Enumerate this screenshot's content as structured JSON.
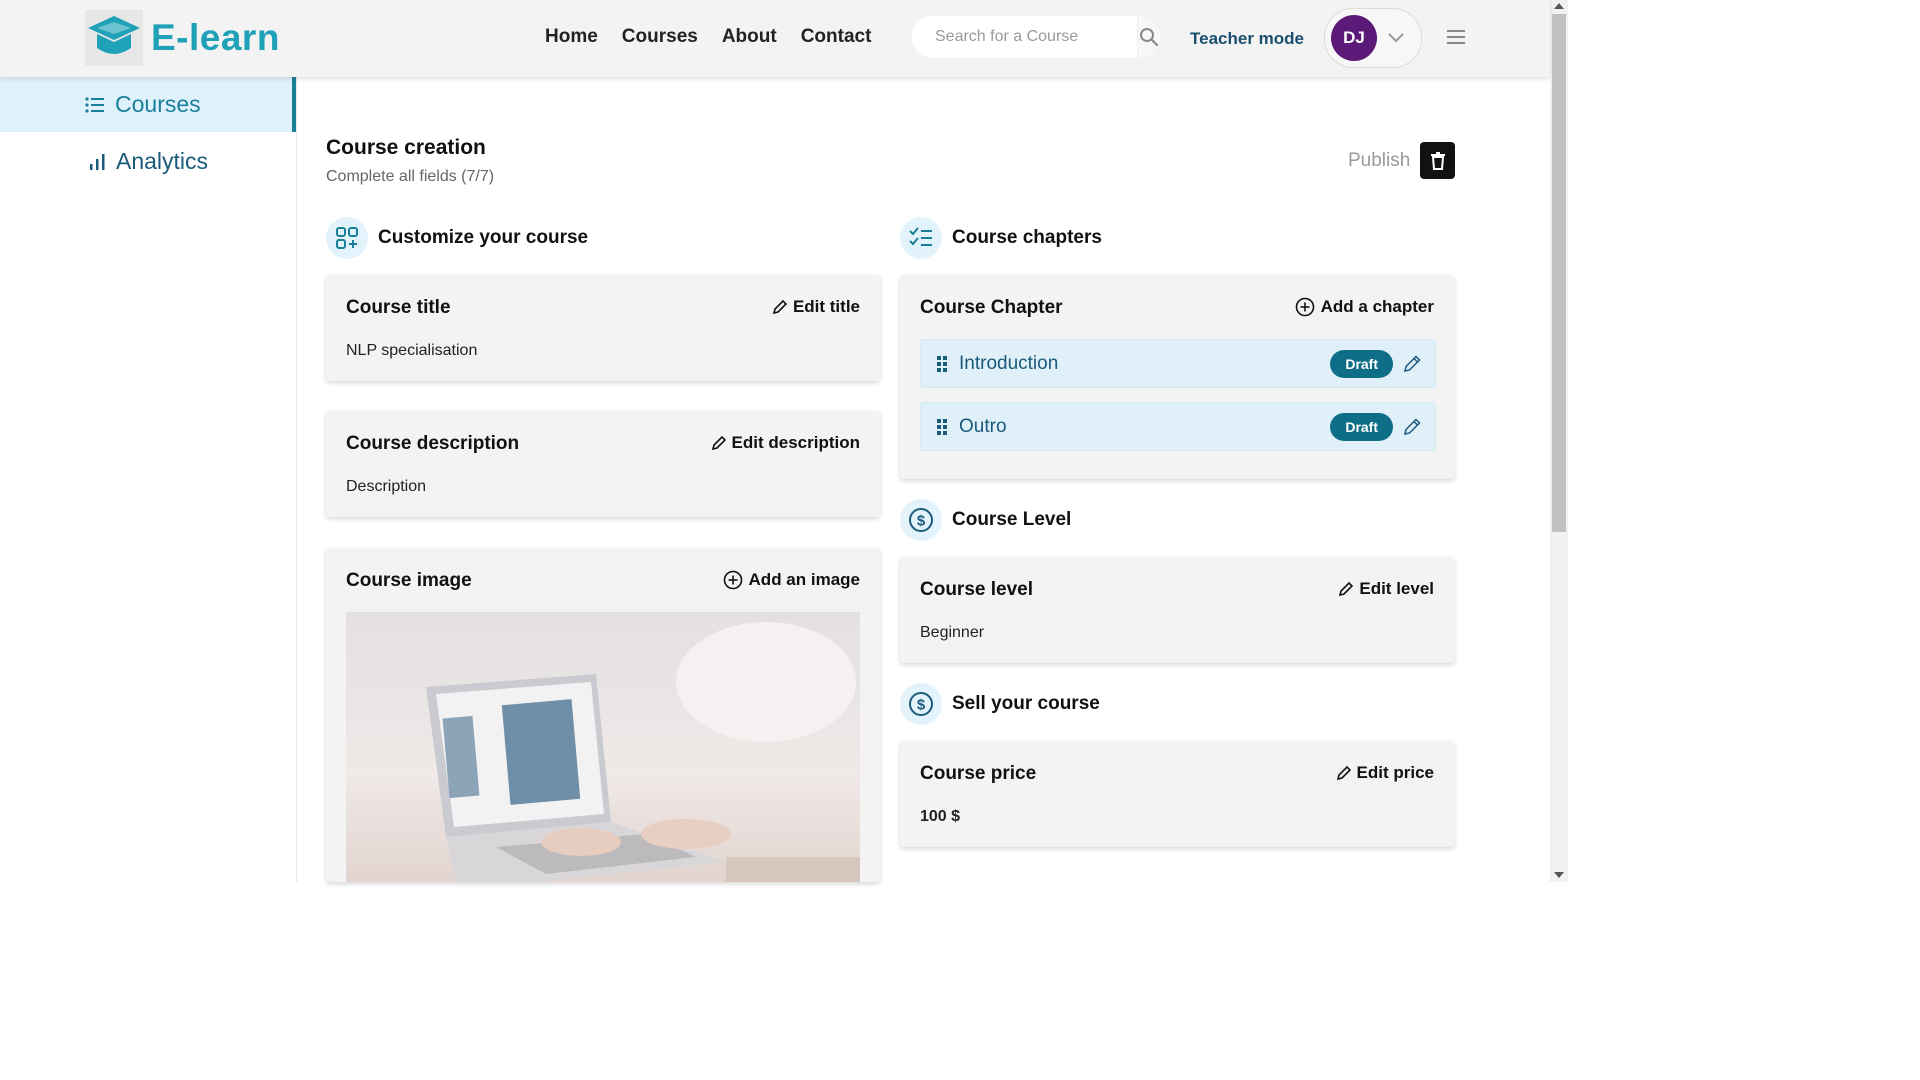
{
  "brand": {
    "name": "E-learn",
    "color": "#1fa2b8"
  },
  "nav": {
    "items": [
      "Home",
      "Courses",
      "About",
      "Contact"
    ]
  },
  "search": {
    "placeholder": "Search for a Course"
  },
  "header": {
    "teacher_mode": "Teacher mode",
    "user_initials": "DJ"
  },
  "sidebar": {
    "items": [
      {
        "label": "Courses",
        "active": true
      },
      {
        "label": "Analytics",
        "active": false
      }
    ]
  },
  "page": {
    "title": "Course creation",
    "subtitle": "Complete all fields (7/7)",
    "publish_label": "Publish"
  },
  "customize": {
    "heading": "Customize your course",
    "title_card": {
      "title": "Course title",
      "action": "Edit title",
      "value": "NLP specialisation"
    },
    "description_card": {
      "title": "Course description",
      "action": "Edit description",
      "value": "Description"
    },
    "image_card": {
      "title": "Course image",
      "action": "Add an image"
    }
  },
  "chapters": {
    "heading": "Course chapters",
    "card_title": "Course Chapter",
    "action": "Add a chapter",
    "items": [
      {
        "name": "Introduction",
        "status": "Draft"
      },
      {
        "name": "Outro",
        "status": "Draft"
      }
    ]
  },
  "level": {
    "heading": "Course Level",
    "card_title": "Course level",
    "action": "Edit level",
    "value": "Beginner"
  },
  "sell": {
    "heading": "Sell your course",
    "card_title": "Course price",
    "action": "Edit price",
    "value": "100 $"
  },
  "colors": {
    "accent": "#1a7f98",
    "badge": "#0f6e87",
    "avatar": "#5b1a78",
    "card_bg": "#f3f3f4"
  }
}
